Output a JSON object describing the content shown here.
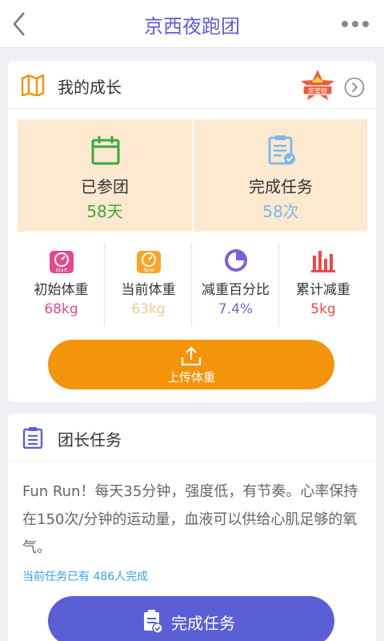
{
  "header": {
    "title": "京西夜跑团",
    "back_icon": "back-chevron-icon",
    "more_icon": "more-dots-icon"
  },
  "growth": {
    "title": "我的成长",
    "badge_text": "荣誉榜",
    "stats": [
      {
        "label": "已参团",
        "value": "58天",
        "color": "#3aa93f",
        "icon": "calendar-icon"
      },
      {
        "label": "完成任务",
        "value": "58次",
        "color": "#7ab8ee",
        "icon": "task-list-icon"
      }
    ],
    "metrics": [
      {
        "label": "初始体重",
        "value": "68kg",
        "color": "#e34a8e",
        "icon_text": "Start",
        "icon": "start-scale-icon"
      },
      {
        "label": "当前体重",
        "value": "63kg",
        "color": "#f3c98c",
        "icon_text": "Now",
        "icon": "now-scale-icon"
      },
      {
        "label": "减重百分比",
        "value": "7.4%",
        "color": "#7b5fe0",
        "icon": "pie-icon"
      },
      {
        "label": "累计减重",
        "value": "5kg",
        "color": "#f04848",
        "icon": "bar-chart-icon"
      }
    ],
    "upload_label": "上传体重"
  },
  "task": {
    "title": "团长任务",
    "description": "Fun Run！每天35分钟，强度低，有节奏。心率保持在150次/分钟的运动量，血液可以供给心肌足够的氧气。",
    "progress_text": "当前任务已有 486人完成",
    "done_label": "完成任务"
  }
}
